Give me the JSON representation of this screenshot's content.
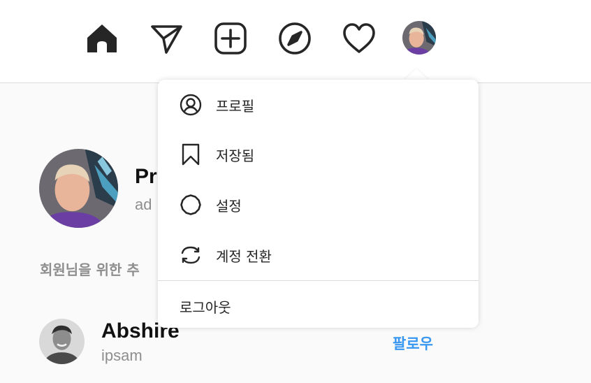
{
  "nav": {
    "items": [
      {
        "icon": "home-icon"
      },
      {
        "icon": "send-icon"
      },
      {
        "icon": "new-post-icon"
      },
      {
        "icon": "explore-compass-icon"
      },
      {
        "icon": "activity-heart-icon"
      },
      {
        "icon": "profile-avatar"
      }
    ]
  },
  "menu": {
    "items": [
      {
        "icon": "profile-circle-icon",
        "label": "프로필"
      },
      {
        "icon": "bookmark-icon",
        "label": "저장됨"
      },
      {
        "icon": "settings-gear-icon",
        "label": "설정"
      },
      {
        "icon": "switch-account-icon",
        "label": "계정 전환"
      }
    ],
    "logout_label": "로그아웃"
  },
  "profile": {
    "name": "Pr",
    "username": "ad"
  },
  "suggestions": {
    "heading": "회원님을 위한 추",
    "users": [
      {
        "name": "Abshire",
        "username": "ipsam",
        "action": "팔로우"
      }
    ]
  },
  "colors": {
    "link_blue": "#3897f0",
    "text_dark": "#262626",
    "text_muted": "#8e8e8e",
    "border": "#dbdbdb",
    "background": "#fafafa"
  }
}
